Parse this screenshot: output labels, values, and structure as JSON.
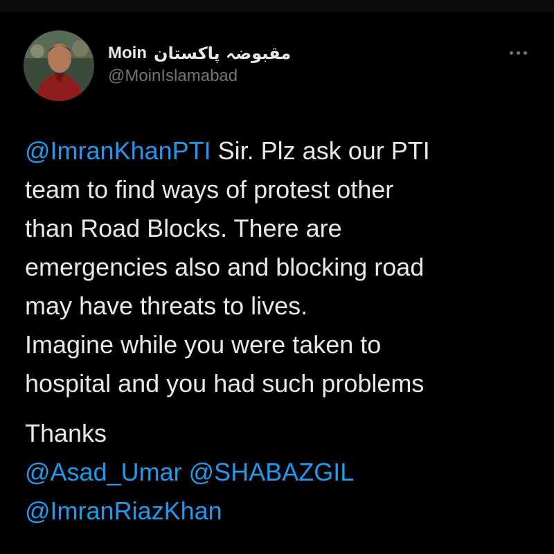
{
  "profile": {
    "display_name": "Moin",
    "urdu_name": "مقبوضہ پاکستان",
    "handle": "@MoinIslamabad",
    "avatar_icon": "profile-photo"
  },
  "actions": {
    "more_icon": "more-options-icon"
  },
  "tweet": {
    "mention_1": "@ImranKhanPTI",
    "line1_rest": " Sir. Plz ask our PTI",
    "line2": "team to find ways of protest other",
    "line3": "than Road Blocks. There are",
    "line4": "emergencies also and blocking road",
    "line5": "may have threats to lives.",
    "line6": "Imagine while you were taken to",
    "line7": "hospital and you had such problems",
    "thanks": "Thanks",
    "mention_2": "@Asad_Umar",
    "mention_3": "@SHABAZGIL",
    "mention_4": "@ImranRiazKhan"
  },
  "colors": {
    "background": "#000000",
    "text": "#e7e9ea",
    "secondary": "#71767b",
    "link": "#1d9bf0"
  }
}
